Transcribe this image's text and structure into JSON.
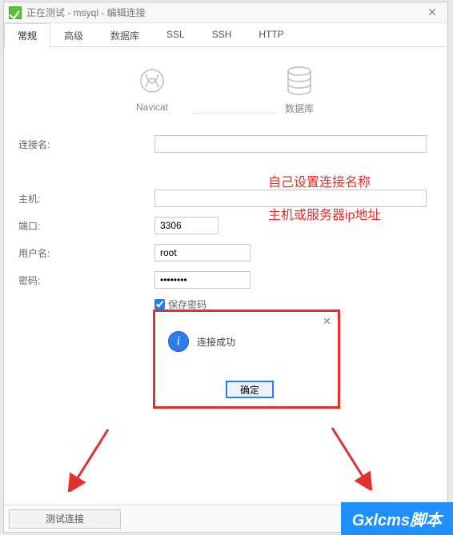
{
  "window": {
    "title": "正在测试 - msyql - 编辑连接"
  },
  "tabs": [
    {
      "label": "常规",
      "active": true
    },
    {
      "label": "高级",
      "active": false
    },
    {
      "label": "数据库",
      "active": false
    },
    {
      "label": "SSL",
      "active": false
    },
    {
      "label": "SSH",
      "active": false
    },
    {
      "label": "HTTP",
      "active": false
    }
  ],
  "icons": {
    "left_label": "Navicat",
    "right_label": "数据库"
  },
  "form": {
    "conn_name_label": "连接名:",
    "conn_name_value": "",
    "host_label": "主机:",
    "host_value": "",
    "port_label": "端口:",
    "port_value": "3306",
    "user_label": "用户名:",
    "user_value": "root",
    "pass_label": "密码:",
    "pass_value": "••••••••",
    "save_pass_label": "保存密码",
    "save_pass_checked": true
  },
  "annotations": {
    "a1": "自己设置连接名称",
    "a2": "主机或服务器ip地址"
  },
  "dialog": {
    "message": "连接成功",
    "ok_label": "确定"
  },
  "footer": {
    "test_label": "测试连接"
  },
  "watermark": {
    "main": "Gxlcms",
    "sub": "脚本"
  },
  "colors": {
    "annotation": "#e03030",
    "accent": "#2b7de9"
  }
}
